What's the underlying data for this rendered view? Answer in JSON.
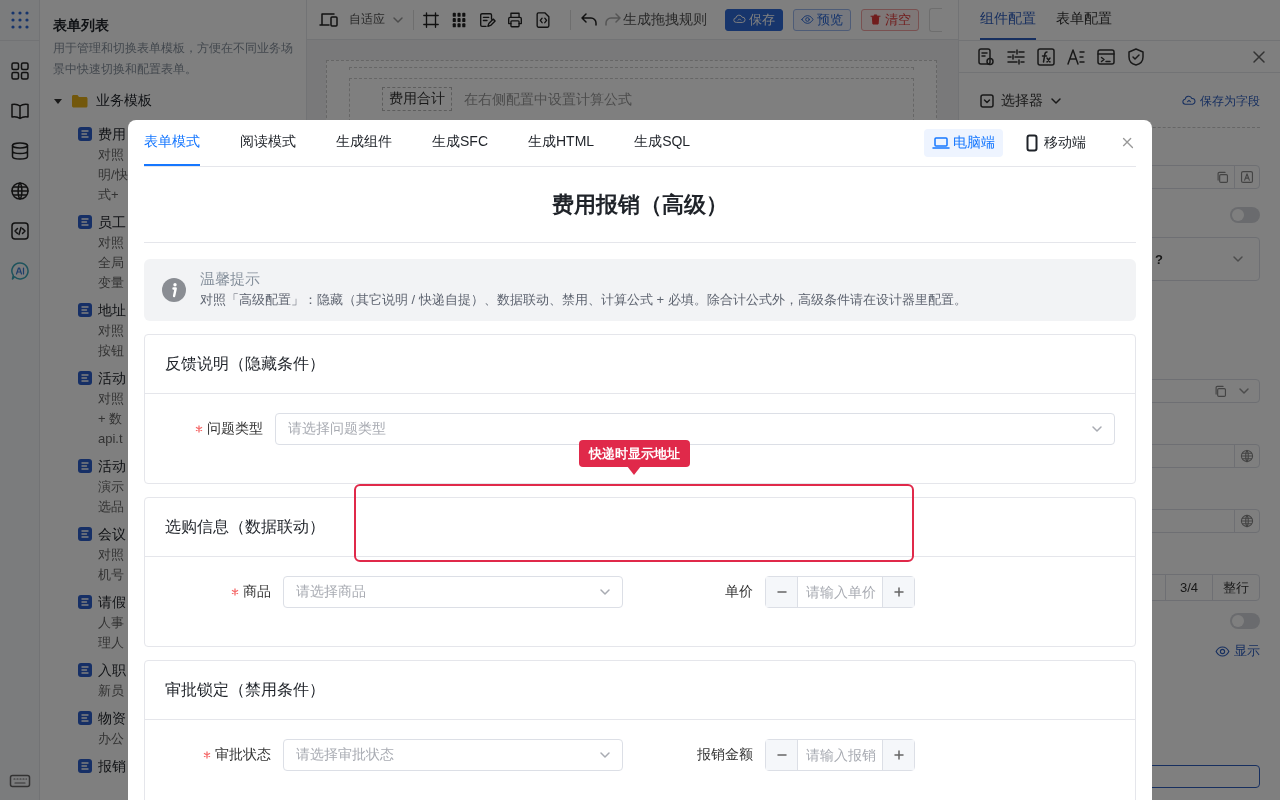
{
  "left_panel": {
    "title": "表单列表",
    "description": "用于管理和切换表单模板，方便在不同业务场景中快速切换和配置表单。",
    "folder": {
      "label": "业务模板",
      "expanded": true,
      "children": [
        {
          "title": "费用",
          "lines": [
            "对照",
            "明/快",
            "式+"
          ]
        },
        {
          "title": "员工",
          "lines": [
            "对照",
            "全局",
            "变量"
          ]
        },
        {
          "title": "地址",
          "lines": [
            "对照",
            "按钮"
          ]
        },
        {
          "title": "活动",
          "lines": [
            "对照",
            "+ 数",
            "api.t"
          ]
        },
        {
          "title": "活动",
          "lines": [
            "演示",
            "选品"
          ]
        },
        {
          "title": "会议",
          "lines": [
            "对照",
            "机号"
          ]
        },
        {
          "title": "请假",
          "lines": [
            "人事",
            "理人"
          ]
        },
        {
          "title": "入职",
          "lines": [
            "新员"
          ]
        },
        {
          "title": "物资",
          "lines": [
            "办公"
          ]
        },
        {
          "title": "报销"
        }
      ]
    }
  },
  "toolbar": {
    "layout_select": "自适应",
    "rule_button": "生成拖拽规则",
    "buttons": [
      {
        "label": "保存",
        "kind": "primary"
      },
      {
        "label": "预览",
        "kind": "outline"
      },
      {
        "label": "清空",
        "kind": "danger"
      }
    ]
  },
  "canvas": {
    "field_label": "费用合计",
    "hint": "在右侧配置中设置计算公式"
  },
  "right_panel": {
    "tabs": [
      {
        "label": "组件配置",
        "selected": true
      },
      {
        "label": "表单配置",
        "selected": false
      }
    ],
    "component_type": "选择器",
    "save_field_link": "保存为字段",
    "toggles": [
      {
        "on": false
      },
      {
        "on": false
      }
    ],
    "select_fragment": "?",
    "width_options": [
      "3/4",
      "整行"
    ],
    "visibility_link": "显示"
  },
  "modal": {
    "tabs": [
      {
        "label": "表单模式",
        "selected": true
      },
      {
        "label": "阅读模式",
        "selected": false
      },
      {
        "label": "生成组件",
        "selected": false
      },
      {
        "label": "生成SFC",
        "selected": false
      },
      {
        "label": "生成HTML",
        "selected": false
      },
      {
        "label": "生成SQL",
        "selected": false
      }
    ],
    "devices": [
      {
        "label": "电脑端",
        "kind": "desktop",
        "selected": true
      },
      {
        "label": "移动端",
        "kind": "mobile",
        "selected": false
      }
    ],
    "title": "费用报销（高级）",
    "notice": {
      "title": "温馨提示",
      "text": "对照「高级配置」：隐藏（其它说明 / 快递自提）、数据联动、禁用、计算公式 + 必填。除合计公式外，高级条件请在设计器里配置。"
    },
    "sections": [
      {
        "title": "反馈说明（隐藏条件）",
        "fields": [
          {
            "label": "问题类型",
            "kind": "select",
            "required": true,
            "placeholder": "请选择问题类型"
          }
        ]
      },
      {
        "title": "选购信息（数据联动）",
        "fields": [
          {
            "label": "商品",
            "kind": "select",
            "required": true,
            "placeholder": "请选择商品"
          },
          {
            "label": "单价",
            "kind": "number",
            "required": false,
            "placeholder": "请输入单价"
          }
        ]
      },
      {
        "title": "审批锁定（禁用条件）",
        "fields": [
          {
            "label": "审批状态",
            "kind": "select",
            "required": true,
            "placeholder": "请选择审批状态"
          },
          {
            "label": "报销金额",
            "kind": "number",
            "required": false,
            "placeholder": "请输入报销"
          }
        ]
      }
    ],
    "tooltip": "快递时显示地址"
  }
}
